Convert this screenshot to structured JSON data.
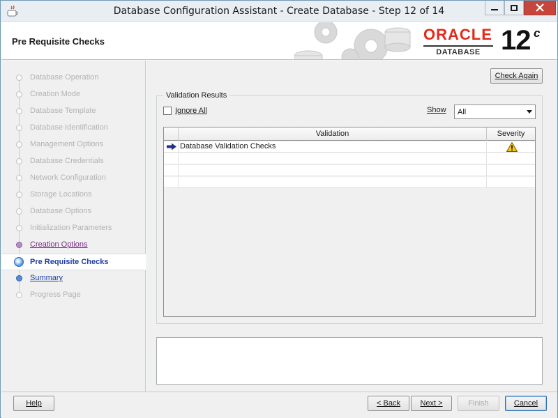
{
  "window": {
    "title": "Database Configuration Assistant - Create Database - Step 12 of 14"
  },
  "header": {
    "page_title": "Pre Requisite Checks",
    "logo_brand": "ORACLE",
    "logo_product": "DATABASE",
    "logo_version": "12",
    "logo_version_sup": "c"
  },
  "nav": {
    "items": [
      {
        "label": "Database Operation",
        "state": "disabled"
      },
      {
        "label": "Creation Mode",
        "state": "disabled"
      },
      {
        "label": "Database Template",
        "state": "disabled"
      },
      {
        "label": "Database Identification",
        "state": "disabled"
      },
      {
        "label": "Management Options",
        "state": "disabled"
      },
      {
        "label": "Database Credentials",
        "state": "disabled"
      },
      {
        "label": "Network Configuration",
        "state": "disabled"
      },
      {
        "label": "Storage Locations",
        "state": "disabled"
      },
      {
        "label": "Database Options",
        "state": "disabled"
      },
      {
        "label": "Initialization Parameters",
        "state": "disabled"
      },
      {
        "label": "Creation Options",
        "state": "visited"
      },
      {
        "label": "Pre Requisite Checks",
        "state": "current"
      },
      {
        "label": "Summary",
        "state": "link"
      },
      {
        "label": "Progress Page",
        "state": "disabled"
      }
    ]
  },
  "main": {
    "check_again_label": "Check Again",
    "group_title": "Validation Results",
    "ignore_all_label": "Ignore All",
    "ignore_all_checked": false,
    "show_label": "Show",
    "show_value": "All",
    "table": {
      "columns": [
        "Validation",
        "Severity"
      ],
      "rows": [
        {
          "validation": "Database Validation Checks",
          "severity": "warning-icon"
        }
      ]
    }
  },
  "footer": {
    "help_label": "Help",
    "back_label": "< Back",
    "next_label": "Next >",
    "finish_label": "Finish",
    "cancel_label": "Cancel"
  },
  "colors": {
    "oracle_red": "#e3291b",
    "nav_link": "#1f3fa5",
    "nav_visited": "#7a2a8a",
    "warning_yellow": "#f5c518"
  }
}
